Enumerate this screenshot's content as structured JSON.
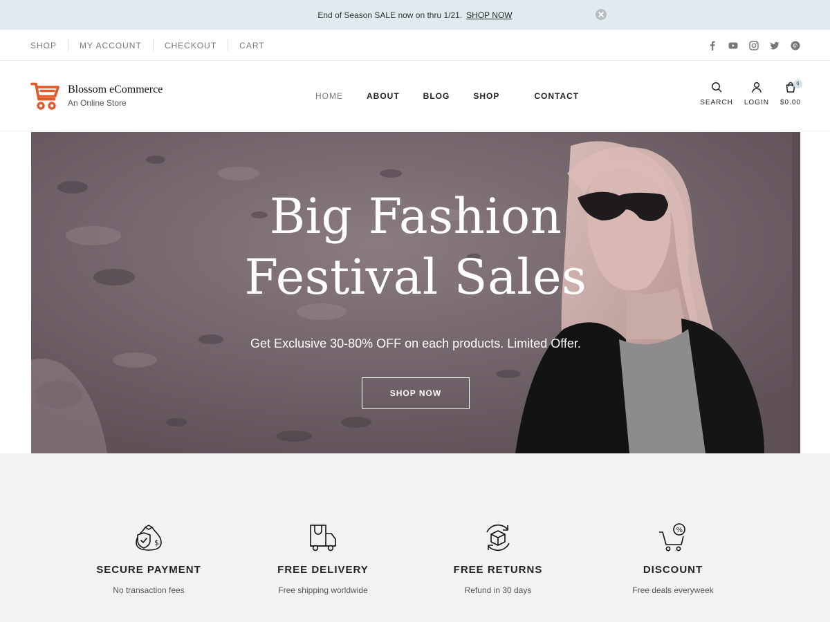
{
  "announcement": {
    "message": "End of Season SALE now on thru 1/21.",
    "link": "SHOP NOW"
  },
  "topbar": {
    "links": [
      "SHOP",
      "MY ACCOUNT",
      "CHECKOUT",
      "CART"
    ],
    "social": [
      "facebook-icon",
      "youtube-icon",
      "instagram-icon",
      "twitter-icon",
      "pinterest-icon"
    ]
  },
  "brand": {
    "name": "Blossom eCommerce",
    "tagline": "An Online Store",
    "accent": "#e35b2b"
  },
  "nav": {
    "items": [
      "HOME",
      "ABOUT",
      "BLOG",
      "SHOP",
      "CONTACT"
    ],
    "active": "HOME"
  },
  "header_icons": {
    "search": "SEARCH",
    "login": "LOGIN",
    "cart_total": "$0.00",
    "cart_count": "0"
  },
  "hero": {
    "title_line1": "Big Fashion",
    "title_line2": "Festival Sales",
    "subtitle": "Get Exclusive 30-80% OFF on each products. Limited Offer.",
    "cta": "SHOP NOW"
  },
  "features": [
    {
      "icon": "money-bag-shield-icon",
      "title": "SECURE PAYMENT",
      "desc": "No transaction fees"
    },
    {
      "icon": "delivery-truck-icon",
      "title": "FREE DELIVERY",
      "desc": "Free shipping worldwide"
    },
    {
      "icon": "return-box-icon",
      "title": "FREE RETURNS",
      "desc": "Refund in 30 days"
    },
    {
      "icon": "discount-cart-icon",
      "title": "DISCOUNT",
      "desc": "Free deals everyweek"
    }
  ]
}
